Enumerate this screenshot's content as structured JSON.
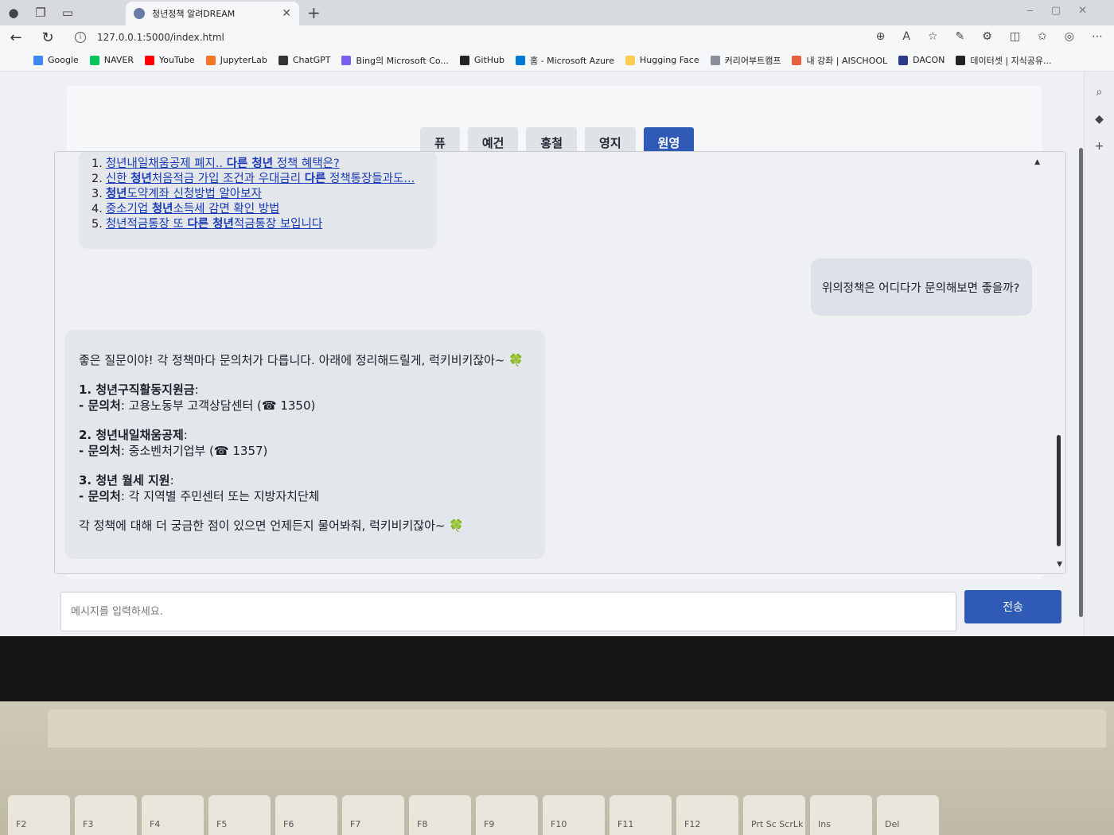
{
  "browser": {
    "tab_title": "청년정책 알려DREAM",
    "url": "127.0.0.1:5000/index.html",
    "bookmarks": [
      {
        "label": "Google",
        "color": "#4285f4"
      },
      {
        "label": "NAVER",
        "color": "#03c75a"
      },
      {
        "label": "YouTube",
        "color": "#ff0000"
      },
      {
        "label": "JupyterLab",
        "color": "#f37726"
      },
      {
        "label": "ChatGPT",
        "color": "#333333"
      },
      {
        "label": "Bing의 Microsoft Co...",
        "color": "#7b5cf0"
      },
      {
        "label": "GitHub",
        "color": "#222222"
      },
      {
        "label": "홈 - Microsoft Azure",
        "color": "#0078d4"
      },
      {
        "label": "Hugging Face",
        "color": "#ffcc4d"
      },
      {
        "label": "커리어부트캠프",
        "color": "#8a8f99"
      },
      {
        "label": "내 강좌 | AISCHOOL",
        "color": "#e8603c"
      },
      {
        "label": "DACON",
        "color": "#2b3a8f"
      },
      {
        "label": "데이터셋 | 지식공유...",
        "color": "#222222"
      }
    ]
  },
  "personas": [
    "퓨",
    "예건",
    "홍철",
    "영지",
    "원영"
  ],
  "active_persona": "원영",
  "chat": {
    "bot1_items": [
      {
        "num": "1.",
        "parts": [
          [
            "청년내일채움공제 폐지.. ",
            false
          ],
          [
            "다른 청년",
            true
          ],
          [
            " 정책 혜택은?",
            false
          ]
        ]
      },
      {
        "num": "2.",
        "parts": [
          [
            "신한 ",
            false
          ],
          [
            "청년",
            true
          ],
          [
            "처음적금 가입 조건과 우대금리 ",
            false
          ],
          [
            "다른",
            true
          ],
          [
            " 정책통장들과도...",
            false
          ]
        ]
      },
      {
        "num": "3.",
        "parts": [
          [
            "청년",
            true
          ],
          [
            "도약계좌 신청방법 알아보자",
            false
          ]
        ]
      },
      {
        "num": "4.",
        "parts": [
          [
            "중소기업 ",
            false
          ],
          [
            "청년",
            true
          ],
          [
            "소득세 감면 확인 방법",
            false
          ]
        ]
      },
      {
        "num": "5.",
        "parts": [
          [
            "청년적금통장 또 ",
            false
          ],
          [
            "다른 청년",
            true
          ],
          [
            "적금통장 보입니다",
            false
          ]
        ]
      }
    ],
    "user_msg": "위의정책은 어디다가 문의해보면 좋을까?",
    "bot2": {
      "intro": "좋은 질문이야! 각 정책마다 문의처가 다릅니다. 아래에 정리해드릴게, 럭키비키잖아~",
      "items": [
        {
          "title": "1. 청년구직활동지원금",
          "contact_label": "- 문의처",
          "contact": ": 고용노동부 고객상담센터 (☎ 1350)"
        },
        {
          "title": "2. 청년내일채움공제",
          "contact_label": "- 문의처",
          "contact": ": 중소벤처기업부 (☎ 1357)"
        },
        {
          "title": "3. 청년 월세 지원",
          "contact_label": "- 문의처",
          "contact": ": 각 지역별 주민센터 또는 지방자치단체"
        }
      ],
      "outro": "각 정책에 대해 더 궁금한 점이 있으면 언제든지 물어봐줘, 럭키비키잖아~",
      "clover": "🍀"
    }
  },
  "input": {
    "placeholder": "메시지를 입력하세요."
  },
  "send_label": "전송",
  "keyboard": [
    "F2",
    "F3",
    "F4",
    "F5",
    "F6",
    "F7",
    "F8",
    "F9",
    "F10",
    "F11",
    "F12",
    "Prt Sc ScrLk",
    "Ins",
    "Del"
  ]
}
